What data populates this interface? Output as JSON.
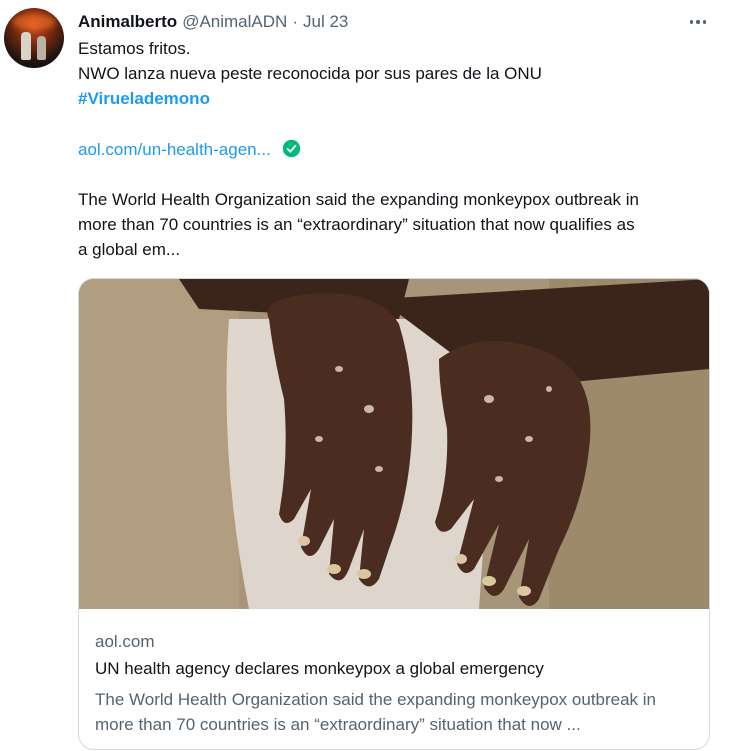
{
  "tweet": {
    "author_name": "Animalberto",
    "author_handle": "@AnimalADN",
    "separator": "·",
    "date": "Jul 23",
    "lines": [
      "Estamos fritos.",
      "NWO lanza nueva peste reconocida por sus pares de la ONU"
    ],
    "hashtag": "#Viruelademono",
    "link_text": "aol.com/un-health-agen...",
    "excerpt": [
      "The World Health Organization said the expanding monkeypox outbreak in",
      "more than 70 countries is an “extraordinary” situation that now qualifies as",
      "a global em..."
    ]
  },
  "card": {
    "domain": "aol.com",
    "title": "UN health agency declares monkeypox a global emergency",
    "description": "The World Health Organization said the expanding monkeypox outbreak in more than 70 countries is an “extraordinary” situation that now ...",
    "image_subject": "hands-with-lesions"
  },
  "icons": {
    "more": "more-options-icon",
    "verified": "verified-check-icon"
  },
  "colors": {
    "link": "#1d9bf0",
    "secondary_text": "#536471",
    "primary_text": "#0f1419",
    "verified": "#00ba7c",
    "border": "#cfd9de"
  }
}
